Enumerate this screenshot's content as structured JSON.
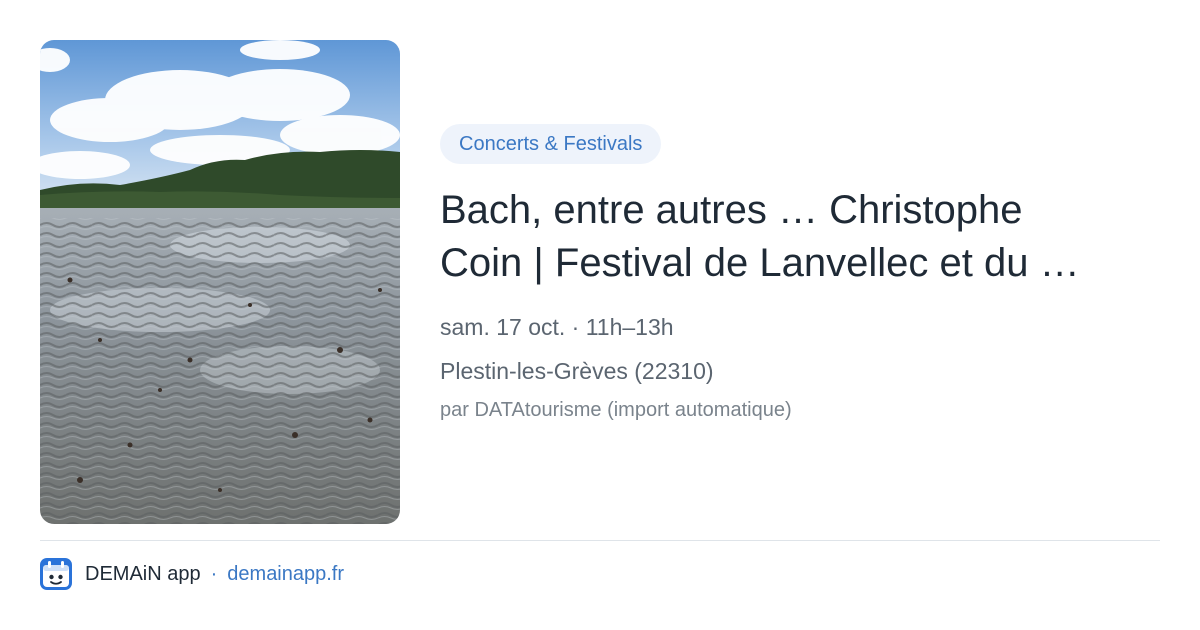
{
  "event": {
    "category": "Concerts & Festivals",
    "title_line_1": "Bach, entre autres … Christophe",
    "title_line_2": "Coin | Festival de Lanvellec et du …",
    "date_time": "sam. 17 oct. · 11h–13h",
    "location": "Plestin-les-Grèves (22310)",
    "source": "par DATAtourisme (import automatique)"
  },
  "footer": {
    "app_name": "DEMAiN app",
    "separator": "·",
    "site": "demainapp.fr"
  },
  "colors": {
    "accent": "#3b78c4",
    "tag_bg": "#eef3fb",
    "title": "#1f2a36",
    "meta": "#5b6570",
    "divider": "#dfe4e9"
  },
  "icons": {
    "app_logo": "demain-app-logo-icon"
  }
}
